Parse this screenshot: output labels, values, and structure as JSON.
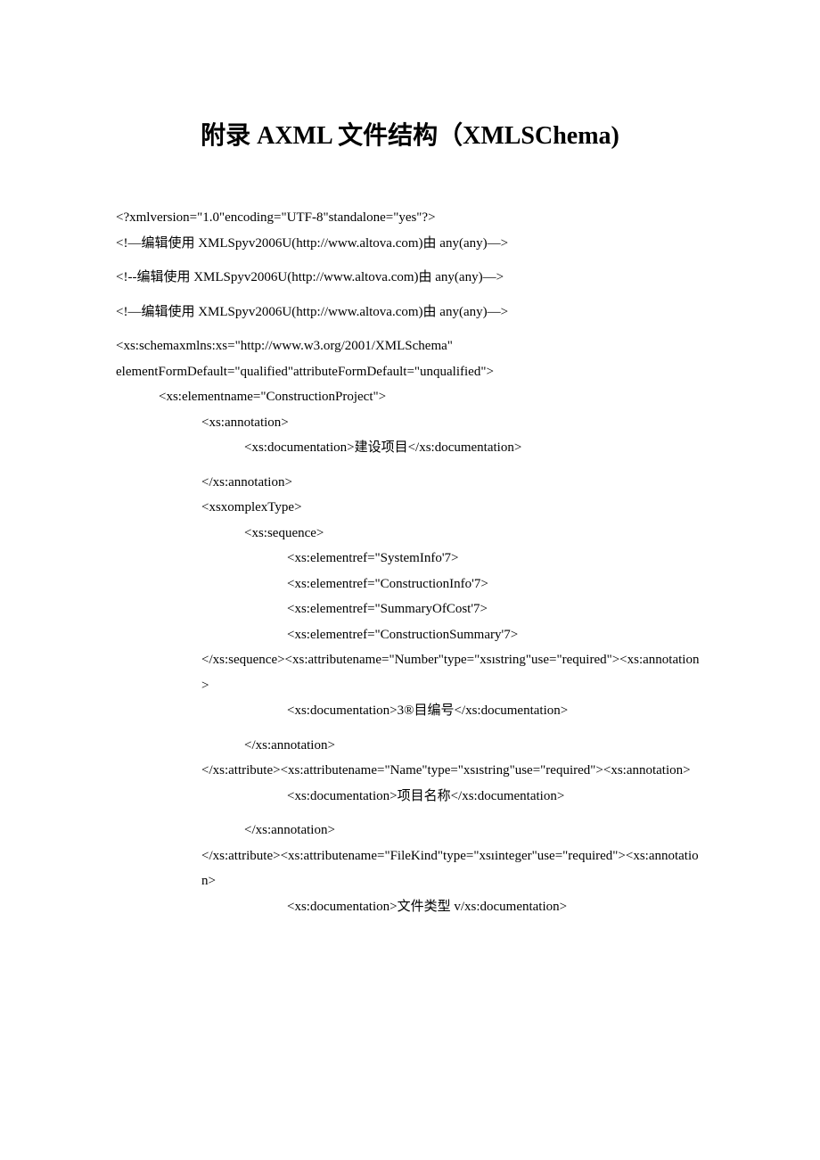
{
  "title": "附录 AXML 文件结构（XMLSChema)",
  "lines": {
    "l0": "<?xmlversion=\"1.0\"encoding=\"UTF-8\"standalone=\"yes\"?>",
    "l1": "<!—编辑使用 XMLSpyv2006U(http://www.altova.com)由 any(any)—>",
    "l2": "<!--编辑使用 XMLSpyv2006U(http://www.altova.com)由 any(any)—>",
    "l3": "<!—编辑使用 XMLSpyv2006U(http://www.altova.com)由 any(any)—>",
    "l4": "<xs:schemaxmlns:xs=\"http://www.w3.org/2001/XMLSchema\"",
    "l5": "elementFormDefault=\"qualified\"attributeFormDefault=\"unqualified\">",
    "l6": "<xs:elementname=\"ConstructionProject\">",
    "l7": "<xs:annotation>",
    "l8": "<xs:documentation>建设项目</xs:documentation>",
    "l9": "</xs:annotation>",
    "l10": "<xsxomplexType>",
    "l11": "<xs:sequence>",
    "l12": "<xs:elementref=\"SystemInfo'7>",
    "l13": "<xs:elementref=\"ConstructionInfo'7>",
    "l14": "<xs:elementref=\"SummaryOfCost'7>",
    "l15": "<xs:elementref=\"ConstructionSummary'7>",
    "l16": "</xs:sequence><xs:attributename=\"Number\"type=\"xsıstring\"use=\"required\"><xs:annotation>",
    "l17": "<xs:documentation>3®目编号</xs:documentation>",
    "l18": "</xs:annotation>",
    "l19": "</xs:attribute><xs:attributename=\"Name\"type=\"xsıstring\"use=\"required\"><xs:annotation>",
    "l20": "<xs:documentation>项目名称</xs:documentation>",
    "l21": "</xs:annotation>",
    "l22": "</xs:attribute><xs:attributename=\"FileKind\"type=\"xsıinteger\"use=\"required\"><xs:annotation>",
    "l23": "<xs:documentation>文件类型 v/xs:documentation>"
  }
}
